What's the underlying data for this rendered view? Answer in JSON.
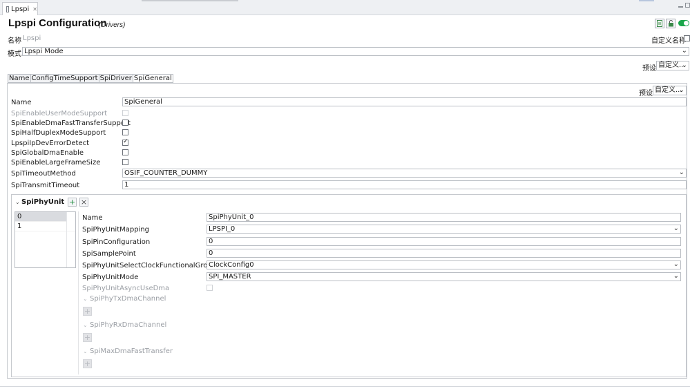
{
  "editor_tab": {
    "label": "Lpspi",
    "close": "✕"
  },
  "header": {
    "title": "Lpspi Configuration",
    "subtitle": "(Drivers)"
  },
  "name_row": {
    "label": "名称",
    "value": "Lpspi",
    "custom_name_label": "自定义名称"
  },
  "mode_row": {
    "label": "模式",
    "value": "Lpspi Mode"
  },
  "preset_top": {
    "label": "预设",
    "value": "自定义..."
  },
  "tabs": [
    {
      "label": "Name"
    },
    {
      "label": "ConfigTimeSupport"
    },
    {
      "label": "SpiDriver"
    },
    {
      "label": "SpiGeneral"
    }
  ],
  "preset_panel": {
    "label": "预设",
    "value": "自定义..."
  },
  "general": {
    "name_label": "Name",
    "name_value": "SpiGeneral",
    "user_mode_label": "SpiEnableUserModeSupport",
    "dma_fast_label": "SpiEnableDmaFastTransferSupport",
    "half_duplex_label": "SpiHalfDuplexModeSupport",
    "dev_error_label": "LpspiIpDevErrorDetect",
    "global_dma_label": "SpiGlobalDmaEnable",
    "large_frame_label": "SpiEnableLargeFrameSize",
    "timeout_method_label": "SpiTimeoutMethod",
    "timeout_method_value": "OSIF_COUNTER_DUMMY",
    "transmit_timeout_label": "SpiTransmitTimeout",
    "transmit_timeout_value": "1",
    "checkboxes": {
      "user_mode": false,
      "dma_fast": false,
      "half_duplex": false,
      "dev_error": true,
      "global_dma": false,
      "large_frame": false
    }
  },
  "phy_unit": {
    "title": "SpiPhyUnit",
    "add_symbol": "+",
    "remove_symbol": "×",
    "items": [
      "0",
      "1"
    ],
    "name_label": "Name",
    "name_value": "SpiPhyUnit_0",
    "mapping_label": "SpiPhyUnitMapping",
    "mapping_value": "LPSPI_0",
    "pin_config_label": "SpiPinConfiguration",
    "pin_config_value": "0",
    "sample_point_label": "SpiSamplePoint",
    "sample_point_value": "0",
    "clock_group_label": "SpiPhyUnitSelectClockFunctionalGroup",
    "clock_group_value": "ClockConfig0",
    "unit_mode_label": "SpiPhyUnitMode",
    "unit_mode_value": "SPI_MASTER",
    "async_dma_label": "SpiPhyUnitAsyncUseDma",
    "tx_dma_label": "SpiPhyTxDmaChannel",
    "rx_dma_label": "SpiPhyRxDmaChannel",
    "max_dma_label": "SpiMaxDmaFastTransfer"
  },
  "colors": {
    "toggle_on": "#1aa64b",
    "add_green": "#1a8a3a"
  },
  "icons": {
    "doc": "doc-icon",
    "lock": "lock-icon",
    "toggle": "toggle-icon",
    "dropdown": "chevron-down-icon"
  }
}
